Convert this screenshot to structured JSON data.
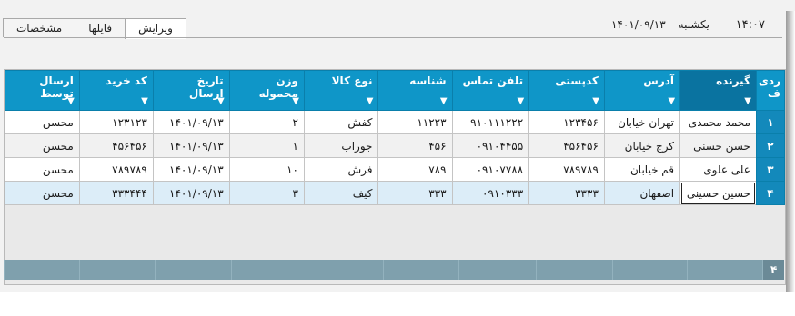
{
  "header": {
    "time": "۱۴:۰۷",
    "day": "یکشنبه",
    "date": "۱۴۰۱/۰۹/۱۳"
  },
  "tabs": [
    {
      "label": "ویرایش",
      "active": true
    },
    {
      "label": "فایلها",
      "active": false
    },
    {
      "label": "مشخصات",
      "active": false
    }
  ],
  "grid": {
    "columns": [
      {
        "key": "rn",
        "label": "ردی ف"
      },
      {
        "key": "receiver",
        "label": "گیرنده"
      },
      {
        "key": "address",
        "label": "آدرس"
      },
      {
        "key": "postal",
        "label": "کدپستی"
      },
      {
        "key": "phone",
        "label": "تلفن تماس"
      },
      {
        "key": "id",
        "label": "شناسه"
      },
      {
        "key": "type",
        "label": "نوع کالا"
      },
      {
        "key": "weight",
        "label": "وزن محموله"
      },
      {
        "key": "date",
        "label": "تاریخ ارسال"
      },
      {
        "key": "code",
        "label": "کد خرید"
      },
      {
        "key": "sender",
        "label": "ارسال توسط"
      }
    ],
    "rows": [
      {
        "rn": "۱",
        "receiver": "محمد محمدی",
        "address": "تهران خیابان",
        "postal": "۱۲۳۴۵۶",
        "phone": "۹۱۰۱۱۱۲۲۲",
        "id": "۱۱۲۲۳",
        "type": "کفش",
        "weight": "۲",
        "date": "۱۴۰۱/۰۹/۱۳",
        "code": "۱۲۳۱۲۳",
        "sender": "محسن"
      },
      {
        "rn": "۲",
        "receiver": "حسن حسنی",
        "address": "کرج خیابان",
        "postal": "۴۵۶۴۵۶",
        "phone": "۰۹۱۰۴۴۵۵",
        "id": "۴۵۶",
        "type": "جوراب",
        "weight": "۱",
        "date": "۱۴۰۱/۰۹/۱۳",
        "code": "۴۵۶۴۵۶",
        "sender": "محسن"
      },
      {
        "rn": "۳",
        "receiver": "علی علوی",
        "address": "قم خیابان",
        "postal": "۷۸۹۷۸۹",
        "phone": "۰۹۱۰۷۷۸۸",
        "id": "۷۸۹",
        "type": "فرش",
        "weight": "۱۰",
        "date": "۱۴۰۱/۰۹/۱۳",
        "code": "۷۸۹۷۸۹",
        "sender": "محسن"
      },
      {
        "rn": "۴",
        "receiver": "حسین حسینی",
        "address": "اصفهان",
        "postal": "۳۳۳۳",
        "phone": "۰۹۱۰۳۳۳",
        "id": "۳۳۳",
        "type": "کیف",
        "weight": "۳",
        "date": "۱۴۰۱/۰۹/۱۳",
        "code": "۳۳۳۴۴۴",
        "sender": "محسن"
      }
    ],
    "footer_count": "۴",
    "colors": {
      "header": "#0f96c8",
      "footer": "#7fa0ad"
    }
  }
}
